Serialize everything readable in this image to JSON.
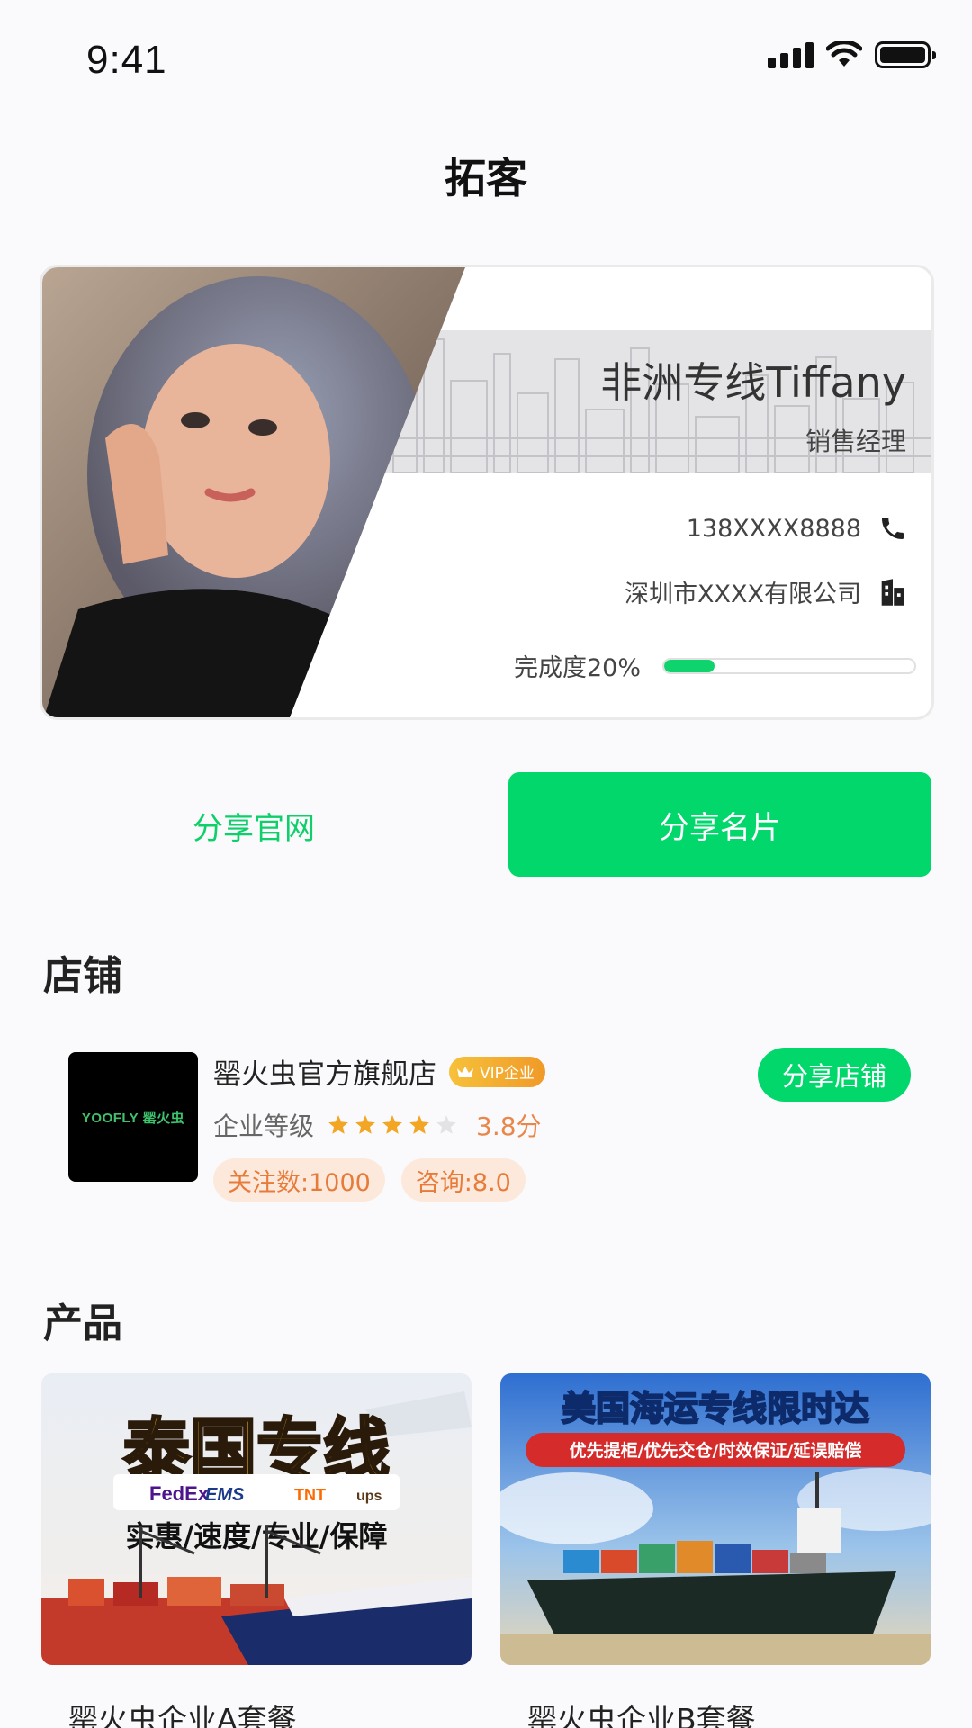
{
  "status_bar": {
    "time": "9:41"
  },
  "nav": {
    "title": "拓客"
  },
  "card": {
    "name": "非洲专线Tiffany",
    "role": "销售经理",
    "phone": "138XXXX8888",
    "company": "深圳市XXXX有限公司",
    "progress_label": "完成度20%",
    "progress": 0.2
  },
  "actions": {
    "share_site": "分享官网",
    "share_card": "分享名片"
  },
  "shop_section": {
    "title": "店铺",
    "logo_text": "YOOFLY 罂火虫",
    "name": "罂火虫官方旗舰店",
    "badge": "VIP企业",
    "level_label": "企业等级",
    "rating": 3.8,
    "score": "3.8分",
    "follow": "关注数:1000",
    "consult": "咨询:8.0",
    "share_button": "分享店铺"
  },
  "product_section": {
    "title": "产品",
    "items": [
      {
        "headline": "泰国专线",
        "carriers": [
          "FedEx",
          "EMS",
          "TNT",
          "ups"
        ],
        "slogan": "实惠/速度/专业/保障",
        "name": "罂火虫企业A套餐"
      },
      {
        "headline": "美国海运专线限时达",
        "ribbon": "优先提柜/优先交仓/时效保证/延误赔偿",
        "name": "罂火虫企业B套餐"
      }
    ]
  },
  "colors": {
    "brand_green": "#02d76c",
    "accent_orange": "#e77b3a",
    "star": "#f2a623"
  }
}
